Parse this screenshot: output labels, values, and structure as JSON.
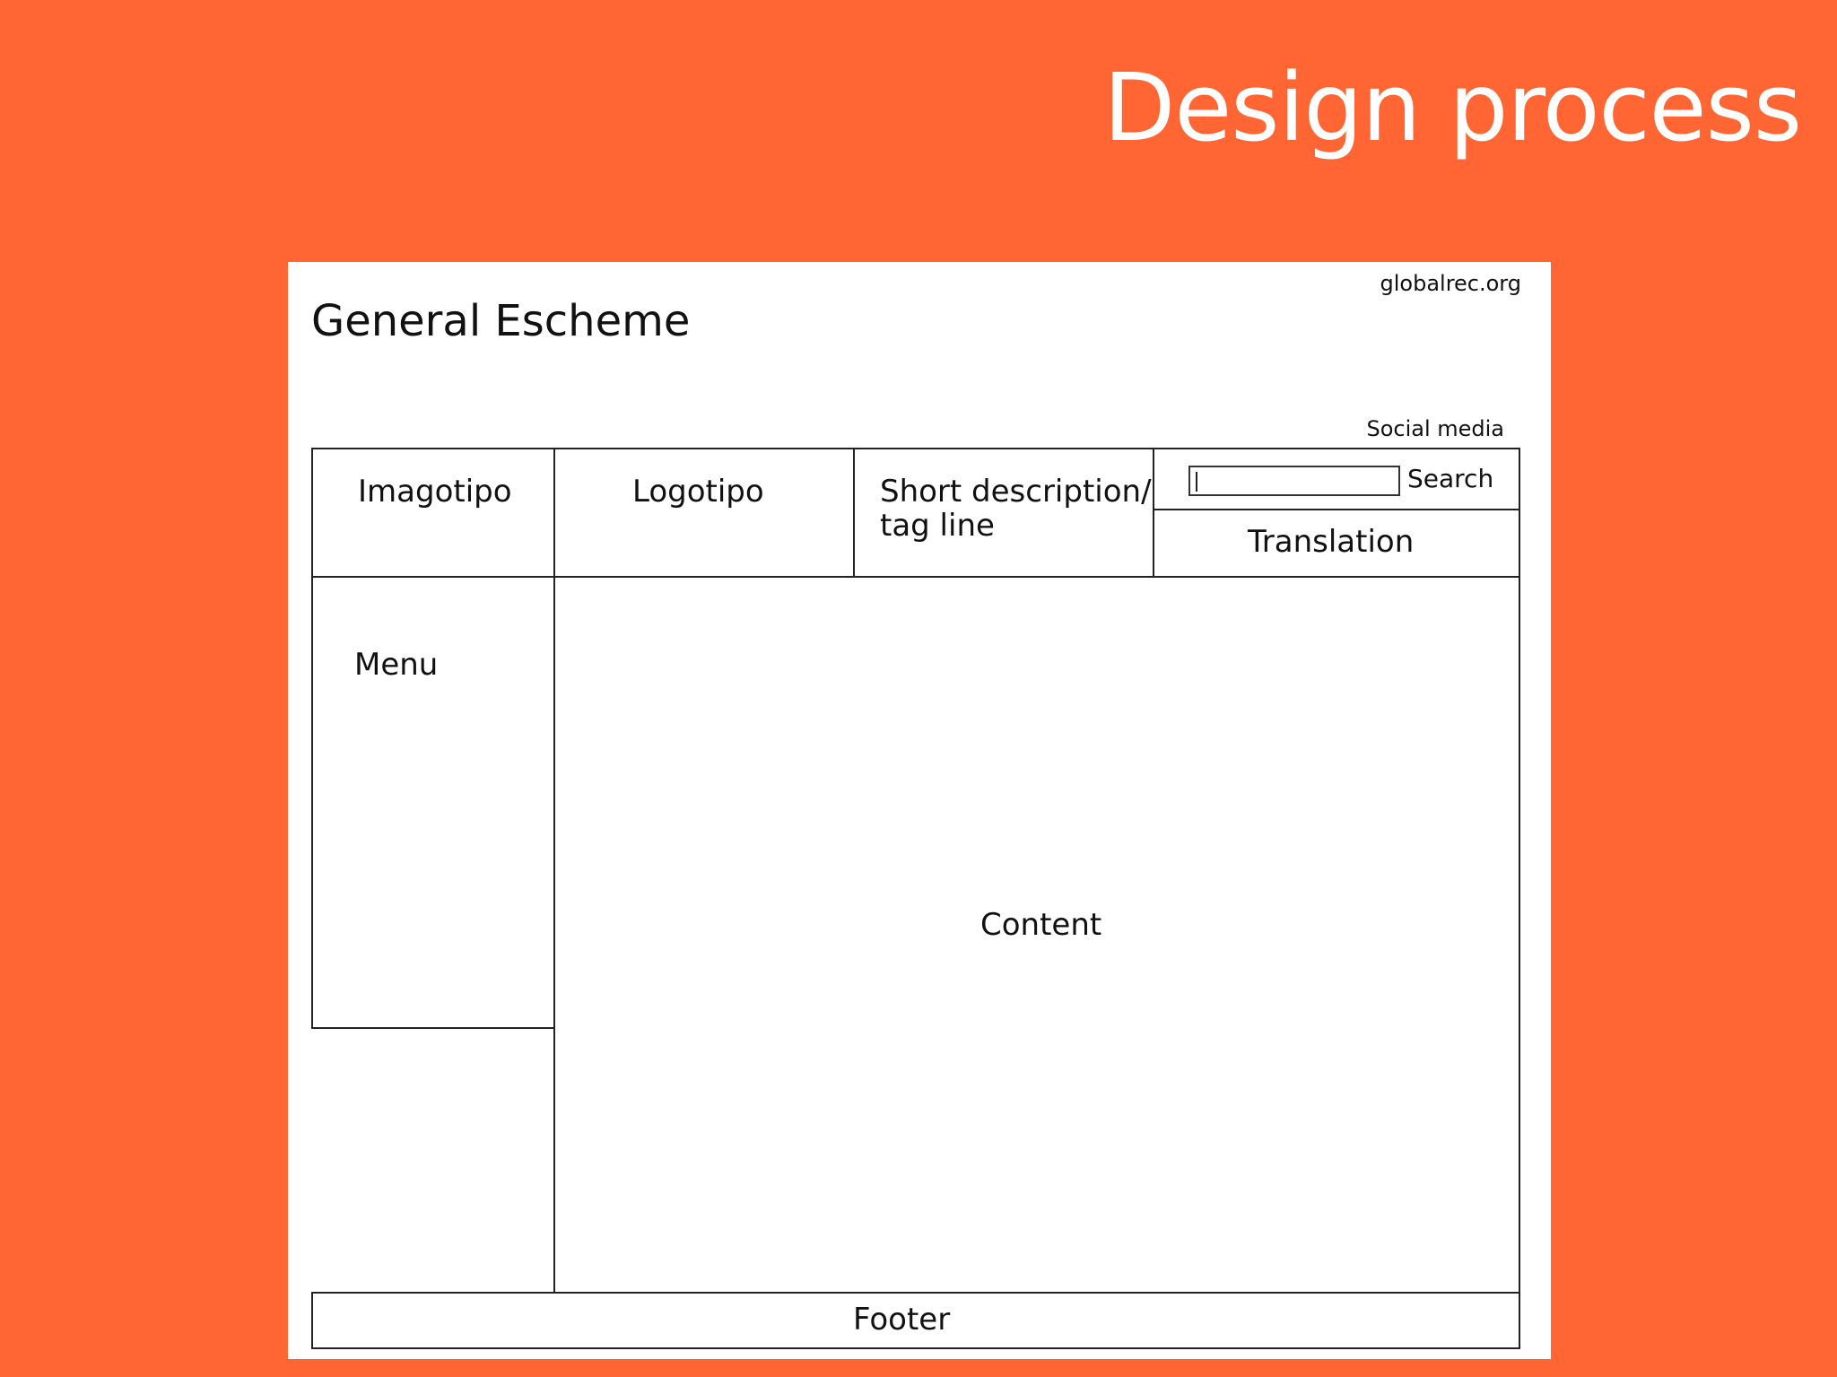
{
  "slide": {
    "title": "Design process"
  },
  "scheme": {
    "site_name": "globalrec.org",
    "title": "General Escheme",
    "social_media": "Social media",
    "imagotipo": "Imagotipo",
    "logotipo": "Logotipo",
    "short_description_line1": "Short description/",
    "short_description_line2": "tag line",
    "search_label": "Search",
    "translation": "Translation",
    "menu": "Menu",
    "content": "Content",
    "footer": "Footer"
  },
  "colors": {
    "background": "#FF6633",
    "sheet": "#FFFFFF",
    "title_text": "#FFFFFF",
    "line": "#222222"
  }
}
